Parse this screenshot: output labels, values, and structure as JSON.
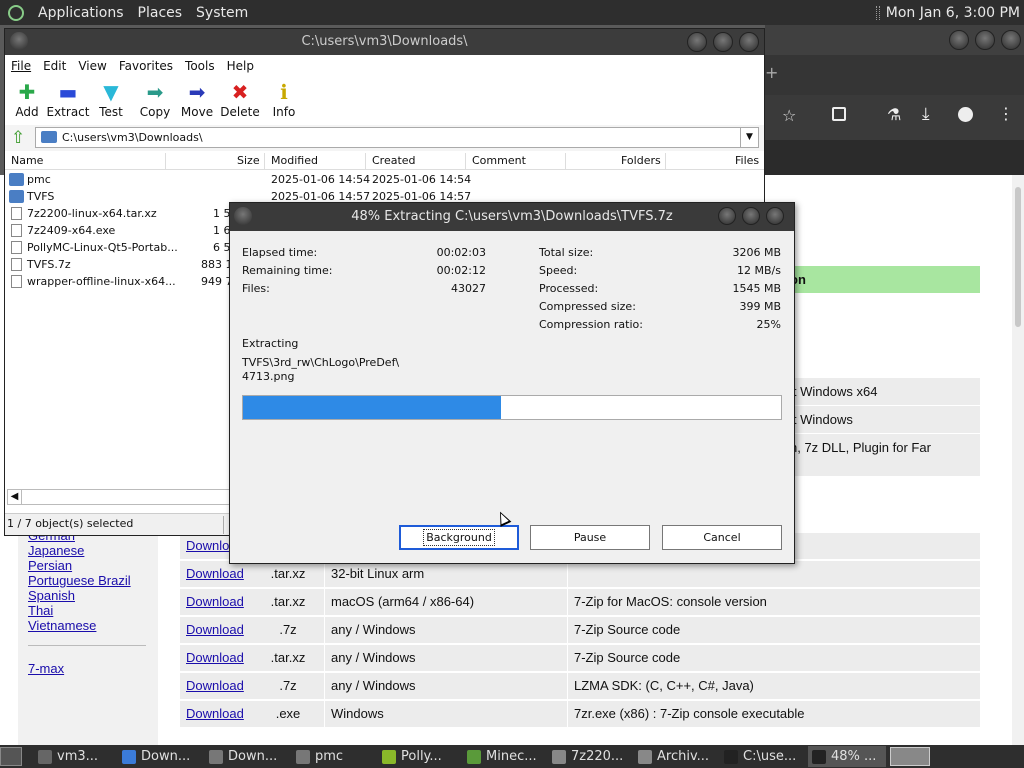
{
  "top_panel": {
    "menus": [
      "Applications",
      "Places",
      "System"
    ],
    "clock": "Mon Jan  6,  3:00 PM"
  },
  "file_manager": {
    "title": "C:\\users\\vm3\\Downloads\\",
    "menu": [
      "File",
      "Edit",
      "View",
      "Favorites",
      "Tools",
      "Help"
    ],
    "toolbar": [
      {
        "label": "Add",
        "icon": "add-icon",
        "glyph": "✚",
        "color": "#2aa84a"
      },
      {
        "label": "Extract",
        "icon": "extract-icon",
        "glyph": "▬",
        "color": "#2a4ad8"
      },
      {
        "label": "Test",
        "icon": "test-icon",
        "glyph": "▼",
        "color": "#2ab8d8"
      },
      {
        "label": "Copy",
        "icon": "copy-icon",
        "glyph": "➡",
        "color": "#2a9a8a"
      },
      {
        "label": "Move",
        "icon": "move-icon",
        "glyph": "➡",
        "color": "#2a3ab8"
      },
      {
        "label": "Delete",
        "icon": "delete-icon",
        "glyph": "✖",
        "color": "#d82020"
      },
      {
        "label": "Info",
        "icon": "info-icon",
        "glyph": "ℹ",
        "color": "#c8a800"
      }
    ],
    "address": "C:\\users\\vm3\\Downloads\\",
    "columns": [
      "Name",
      "Size",
      "Modified",
      "Created",
      "Comment",
      "Folders",
      "Files"
    ],
    "rows": [
      {
        "name": "pmc",
        "type": "folder",
        "size": "",
        "modified": "2025-01-06 14:54",
        "created": "2025-01-06 14:54"
      },
      {
        "name": "TVFS",
        "type": "folder",
        "size": "",
        "modified": "2025-01-06 14:57",
        "created": "2025-01-06 14:57"
      },
      {
        "name": "7z2200-linux-x64.tar.xz",
        "type": "file",
        "size": "1 5",
        "modified": "",
        "created": ""
      },
      {
        "name": "7z2409-x64.exe",
        "type": "file",
        "size": "1 6",
        "modified": "",
        "created": ""
      },
      {
        "name": "PollyMC-Linux-Qt5-Portab...",
        "type": "file",
        "size": "6 5",
        "modified": "",
        "created": ""
      },
      {
        "name": "TVFS.7z",
        "type": "file",
        "size": "883 1",
        "modified": "",
        "created": ""
      },
      {
        "name": "wrapper-offline-linux-x64...",
        "type": "file",
        "size": "949 7",
        "modified": "",
        "created": ""
      }
    ],
    "status": "1 / 7 object(s) selected"
  },
  "dialog": {
    "title": "48% Extracting C:\\users\\vm3\\Downloads\\TVFS.7z",
    "left_stats": [
      {
        "label": "Elapsed time:",
        "value": "00:02:03"
      },
      {
        "label": "Remaining time:",
        "value": "00:02:12"
      },
      {
        "label": "Files:",
        "value": "43027"
      }
    ],
    "right_stats": [
      {
        "label": "Total size:",
        "value": "3206 MB"
      },
      {
        "label": "Speed:",
        "value": "12 MB/s"
      },
      {
        "label": "Processed:",
        "value": "1545 MB"
      },
      {
        "label": "Compressed size:",
        "value": "399 MB"
      },
      {
        "label": "Compression ratio:",
        "value": "25%"
      }
    ],
    "operation": "Extracting",
    "current_path": "TVFS\\3rd_rw\\ChLogo\\PreDef\\",
    "current_file": "4713.png",
    "progress": 0.48,
    "buttons": {
      "background": "Background",
      "pause": "Pause",
      "cancel": "Cancel"
    }
  },
  "webpage": {
    "languages": [
      "German",
      "Japanese",
      "Persian",
      "Portuguese Brazil",
      "Spanish",
      "Thai",
      "Vietnamese"
    ],
    "seven_max": "7-max",
    "header_fragment": "on",
    "right_fragments": [
      "it Windows x64",
      "it Windows",
      "n, 7z DLL, Plugin for Far"
    ],
    "download_rows": [
      {
        "link": "Download",
        "ext": "",
        "system": "",
        "desc": ""
      },
      {
        "link": "Download",
        "ext": ".tar.xz",
        "system": "32-bit Linux arm",
        "desc": ""
      },
      {
        "link": "Download",
        "ext": ".tar.xz",
        "system": "macOS (arm64 / x86-64)",
        "desc": "7-Zip for MacOS: console version"
      },
      {
        "link": "Download",
        "ext": ".7z",
        "system": "any / Windows",
        "desc": "7-Zip Source code"
      },
      {
        "link": "Download",
        "ext": ".tar.xz",
        "system": "any / Windows",
        "desc": "7-Zip Source code"
      },
      {
        "link": "Download",
        "ext": ".7z",
        "system": "any / Windows",
        "desc": "LZMA SDK: (C, C++, C#, Java)"
      },
      {
        "link": "Download",
        "ext": ".exe",
        "system": "Windows",
        "desc": "7zr.exe (x86) : 7-Zip console executable"
      }
    ]
  },
  "taskbar": [
    {
      "label": "vm3...",
      "color": "#666"
    },
    {
      "label": "Down...",
      "color": "#3b7bd8"
    },
    {
      "label": "Down...",
      "color": "#777"
    },
    {
      "label": "pmc",
      "color": "#777"
    },
    {
      "label": "Polly...",
      "color": "#8ab82a"
    },
    {
      "label": "Minec...",
      "color": "#5a9a3a"
    },
    {
      "label": "7z220...",
      "color": "#888"
    },
    {
      "label": "Archiv...",
      "color": "#888"
    },
    {
      "label": "C:\\use...",
      "color": "#222"
    },
    {
      "label": "48% ...",
      "color": "#222"
    }
  ]
}
